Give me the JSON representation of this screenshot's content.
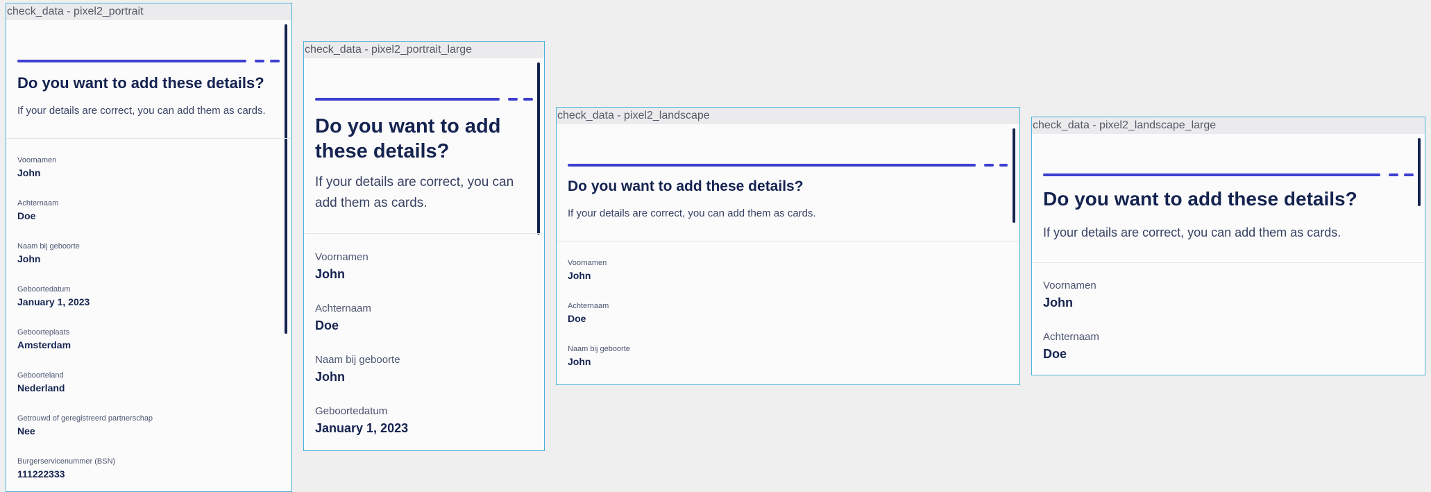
{
  "colors": {
    "background": "#efefef",
    "frame_border": "#4ab0d9",
    "progress": "#3c3fd0",
    "heading": "#152350",
    "scrollbar": "#152350"
  },
  "devices": [
    {
      "title": "check_data - pixel2_portrait",
      "heading": "Do you want to add these details?",
      "subtext": "If your details are correct, you can add them as cards.",
      "fields": [
        {
          "label": "Voornamen",
          "value": "John"
        },
        {
          "label": "Achternaam",
          "value": "Doe"
        },
        {
          "label": "Naam bij geboorte",
          "value": "John"
        },
        {
          "label": "Geboortedatum",
          "value": "January 1, 2023"
        },
        {
          "label": "Geboorteplaats",
          "value": "Amsterdam"
        },
        {
          "label": "Geboorteland",
          "value": "Nederland"
        },
        {
          "label": "Getrouwd of geregistreerd partnerschap",
          "value": "Nee"
        },
        {
          "label": "Burgerservicenummer (BSN)",
          "value": "111222333"
        }
      ]
    },
    {
      "title": "check_data - pixel2_portrait_large",
      "heading": "Do you want to add these details?",
      "subtext": "If your details are correct, you can add them as cards.",
      "fields": [
        {
          "label": "Voornamen",
          "value": "John"
        },
        {
          "label": "Achternaam",
          "value": "Doe"
        },
        {
          "label": "Naam bij geboorte",
          "value": "John"
        },
        {
          "label": "Geboortedatum",
          "value": "January 1, 2023"
        }
      ]
    },
    {
      "title": "check_data - pixel2_landscape",
      "heading": "Do you want to add these details?",
      "subtext": "If your details are correct, you can add them as cards.",
      "fields": [
        {
          "label": "Voornamen",
          "value": "John"
        },
        {
          "label": "Achternaam",
          "value": "Doe"
        },
        {
          "label": "Naam bij geboorte",
          "value": "John"
        }
      ]
    },
    {
      "title": "check_data - pixel2_landscape_large",
      "heading": "Do you want to add these details?",
      "subtext": "If your details are correct, you can add them as cards.",
      "fields": [
        {
          "label": "Voornamen",
          "value": "John"
        },
        {
          "label": "Achternaam",
          "value": "Doe"
        }
      ]
    }
  ]
}
